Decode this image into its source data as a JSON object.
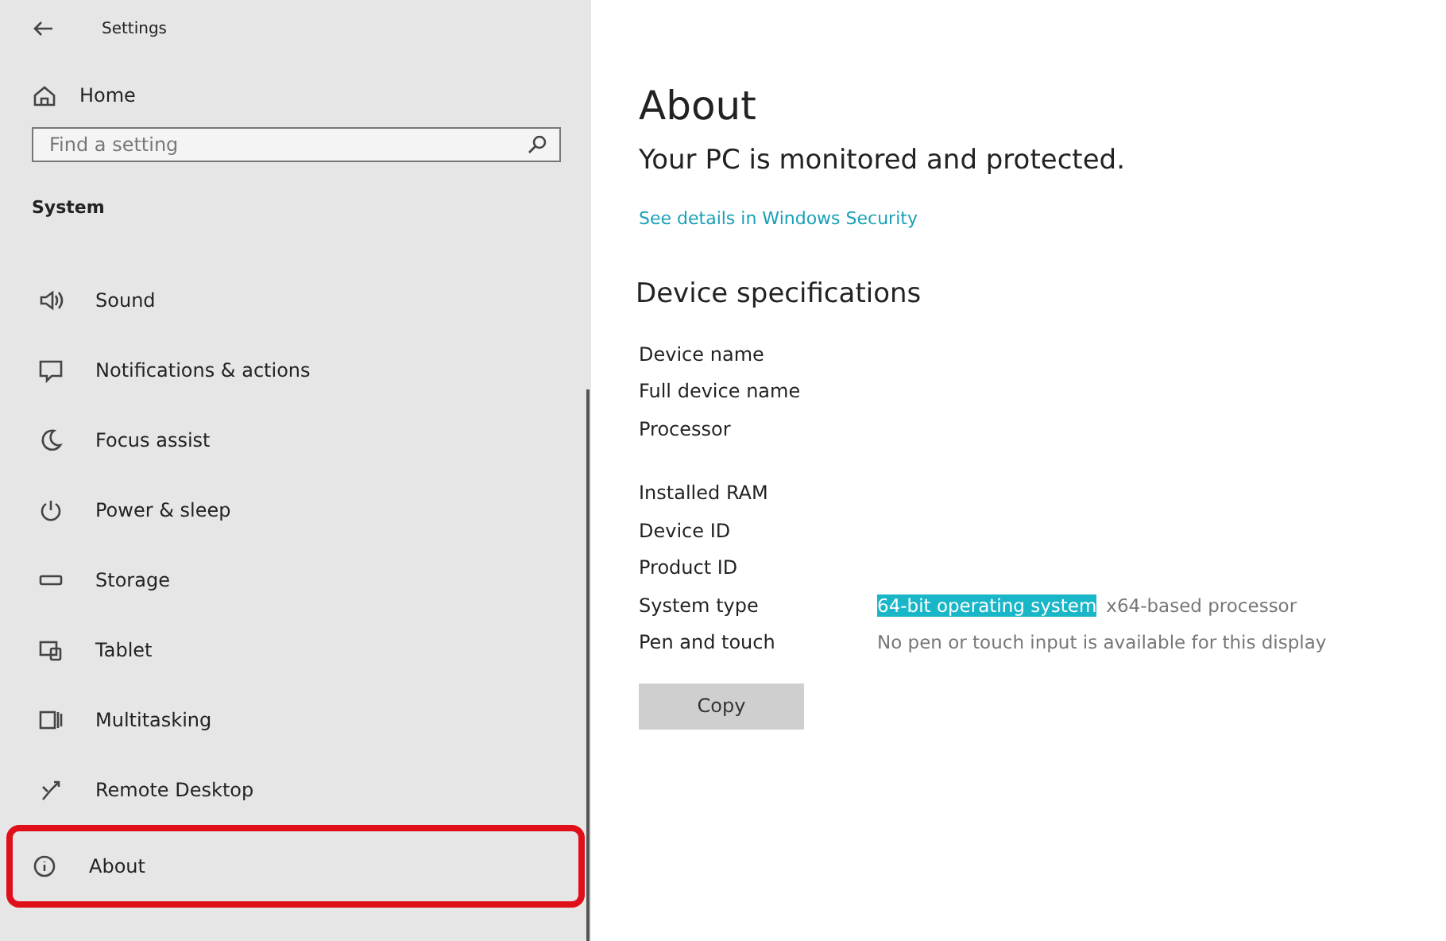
{
  "window": {
    "title": "Settings"
  },
  "sidebar": {
    "home": "Home",
    "search": {
      "placeholder": "Find a setting"
    },
    "section": "System",
    "items": [
      {
        "label": "Sound",
        "annotated": false
      },
      {
        "label": "Notifications & actions",
        "annotated": false
      },
      {
        "label": "Focus assist",
        "annotated": false
      },
      {
        "label": "Power & sleep",
        "annotated": false
      },
      {
        "label": "Storage",
        "annotated": false
      },
      {
        "label": "Tablet",
        "annotated": false
      },
      {
        "label": "Multitasking",
        "annotated": false
      },
      {
        "label": "Remote Desktop",
        "annotated": false
      },
      {
        "label": "About",
        "annotated": true
      }
    ]
  },
  "main": {
    "title": "About",
    "status": "Your PC is monitored and protected.",
    "link": "See details in Windows Security",
    "specs_title": "Device specifications",
    "spec_groups": [
      [
        {
          "label": "Device name"
        },
        {
          "label": "Full device name"
        },
        {
          "label": "Processor"
        }
      ],
      [
        {
          "label": "Installed RAM"
        },
        {
          "label": "Device ID"
        },
        {
          "label": "Product ID"
        },
        {
          "label": "System type",
          "segments": [
            {
              "text": "64-bit operating system",
              "selected": true
            },
            {
              "text": "x64-based processor",
              "selected": false
            }
          ]
        },
        {
          "label": "Pen and touch",
          "segments": [
            {
              "text": "No pen or touch input is available for this display",
              "selected": false
            }
          ]
        }
      ]
    ],
    "button": "Copy"
  }
}
